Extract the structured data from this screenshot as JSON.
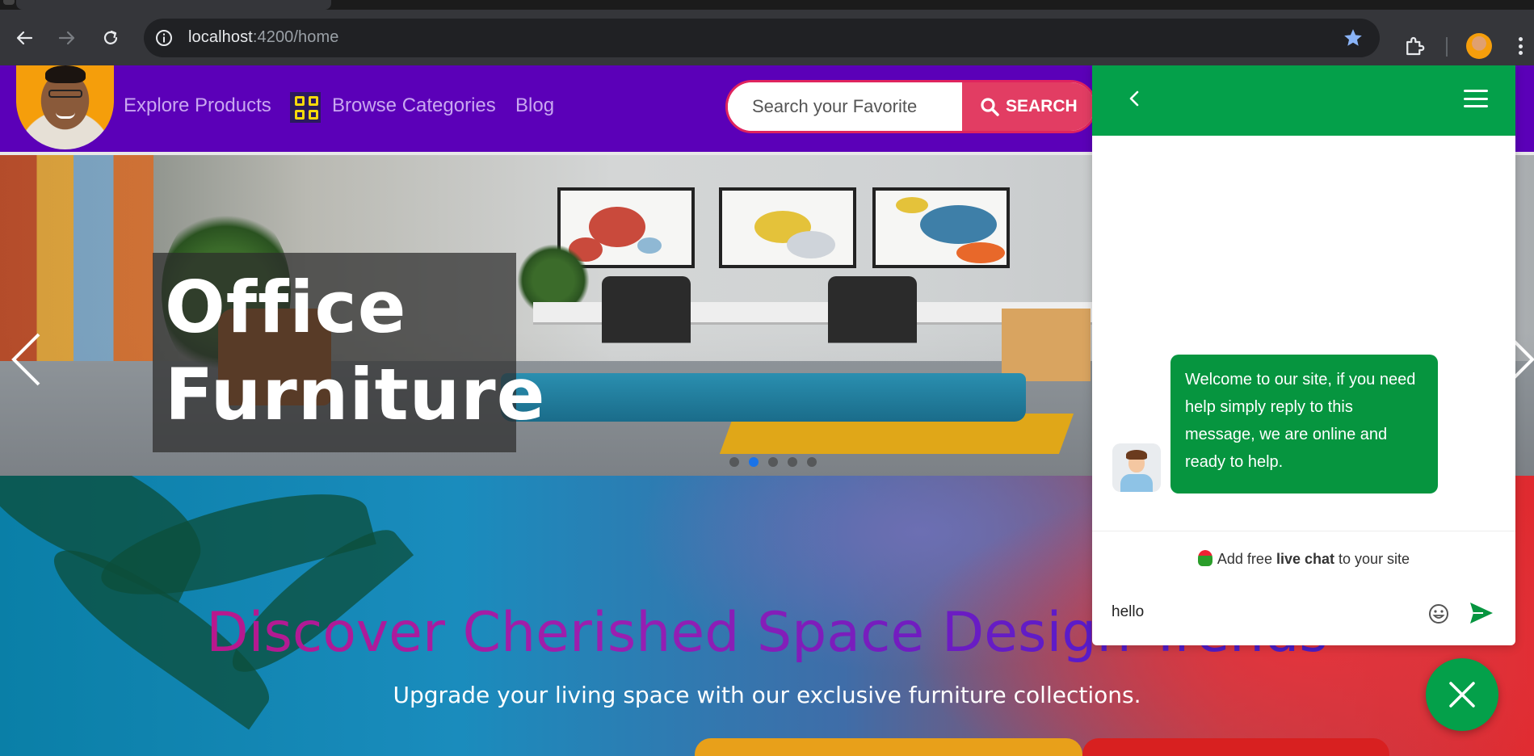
{
  "browser": {
    "url_host": "localhost",
    "url_path": ":4200/home",
    "icons": [
      "back-icon",
      "forward-icon",
      "reload-icon",
      "site-info-icon",
      "bookmark-star-icon",
      "extensions-icon",
      "profile-avatar",
      "menu-kebab-icon"
    ]
  },
  "header": {
    "nav": {
      "explore": "Explore Products",
      "categories": "Browse Categories",
      "blog": "Blog"
    },
    "search": {
      "placeholder": "Search your Favorite",
      "button_label": "SEARCH"
    },
    "colors": {
      "background": "#5b00b8",
      "search_accent": "#e23d63"
    }
  },
  "hero": {
    "title_line1": "Office",
    "title_line2": "Furniture",
    "slide_count": 5,
    "active_slide": 2
  },
  "promo": {
    "heading": "Discover Cherished Space Design Trends",
    "subheading": "Upgrade your living space with our exclusive furniture collections."
  },
  "chat": {
    "welcome_message": "Welcome to our site, if you need help simply reply to this message, we are online and ready to help.",
    "branding_prefix": "Add free",
    "branding_bold": "live chat",
    "branding_suffix": "to your site",
    "input_value": "hello",
    "colors": {
      "primary": "#04a04a",
      "bubble": "#06953f"
    }
  }
}
